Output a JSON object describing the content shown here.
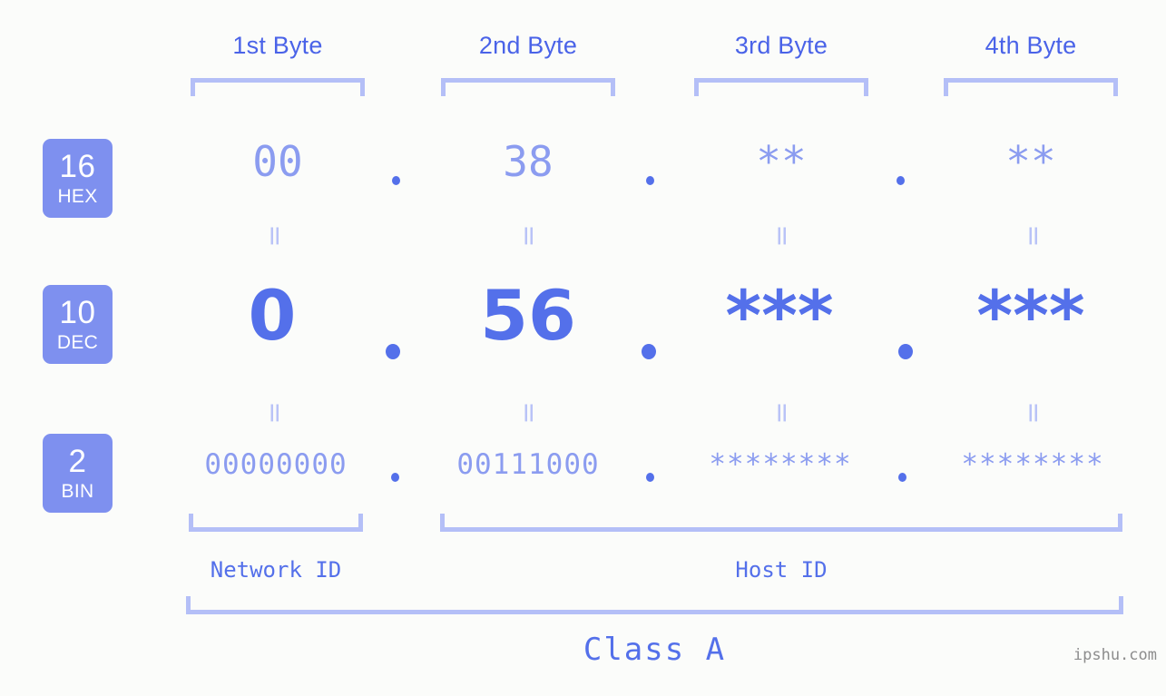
{
  "background_color": "#fbfcfa",
  "accent_color": "#5470ea",
  "accent_light_color": "#8b9cf0",
  "bracket_color": "#b4bff7",
  "badge_color": "#7e90ef",
  "byte_headers": [
    {
      "label": "1st Byte"
    },
    {
      "label": "2nd Byte"
    },
    {
      "label": "3rd Byte"
    },
    {
      "label": "4th Byte"
    }
  ],
  "rows": [
    {
      "base": "16",
      "base_label": "HEX",
      "octets": [
        "00",
        "38",
        "**",
        "**"
      ]
    },
    {
      "base": "10",
      "base_label": "DEC",
      "octets": [
        "0",
        "56",
        "***",
        "***"
      ]
    },
    {
      "base": "2",
      "base_label": "BIN",
      "octets": [
        "00000000",
        "00111000",
        "********",
        "********"
      ]
    }
  ],
  "separator": ".",
  "equals_mark": "=",
  "segments": {
    "network_id": "Network ID",
    "host_id": "Host ID"
  },
  "class_label": "Class A",
  "watermark": "ipshu.com"
}
